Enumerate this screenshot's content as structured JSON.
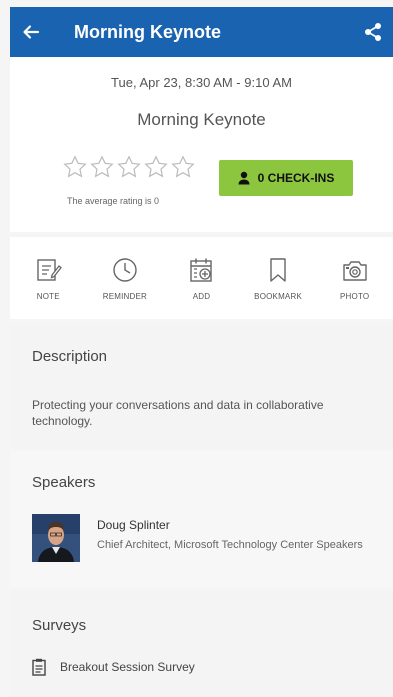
{
  "topbar": {
    "title": "Morning Keynote",
    "icons": {
      "back": "back-arrow-icon",
      "share": "share-icon"
    },
    "color": "#1a63b0"
  },
  "session": {
    "datetime": "Tue, Apr 23, 8:30 AM - 9:10 AM",
    "title": "Morning Keynote",
    "rating_text": "The average rating is 0",
    "rating": 0,
    "rating_max": 5,
    "checkins_label": "0 CHECK-INS",
    "checkins_color": "#8cc63e"
  },
  "actions": [
    {
      "label": "NOTE",
      "icon": "note-icon"
    },
    {
      "label": "REMINDER",
      "icon": "clock-icon"
    },
    {
      "label": "ADD",
      "icon": "calendar-add-icon"
    },
    {
      "label": "BOOKMARK",
      "icon": "bookmark-icon"
    },
    {
      "label": "PHOTO",
      "icon": "camera-icon"
    }
  ],
  "description": {
    "heading": "Description",
    "body": "Protecting your conversations and data in collaborative technology."
  },
  "speakers": {
    "heading": "Speakers",
    "items": [
      {
        "name": "Doug Splinter",
        "role": "Chief Architect, Microsoft Technology Center Speakers"
      }
    ]
  },
  "surveys": {
    "heading": "Surveys",
    "items": [
      {
        "label": "Breakout Session Survey",
        "icon": "clipboard-icon"
      }
    ]
  }
}
